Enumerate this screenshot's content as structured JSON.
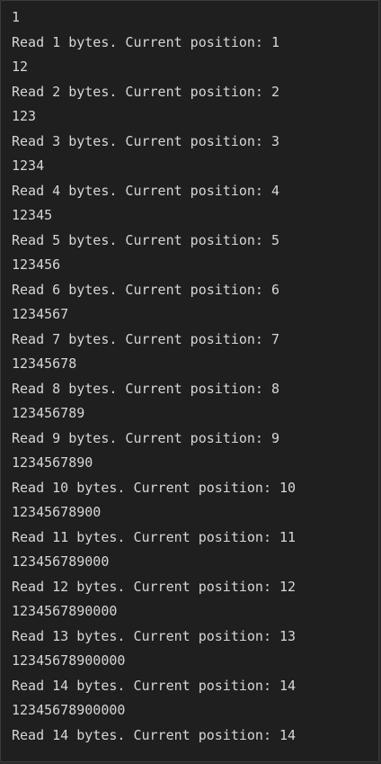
{
  "console": {
    "lines": [
      "1",
      "Read 1 bytes. Current position: 1",
      "12",
      "Read 2 bytes. Current position: 2",
      "123",
      "Read 3 bytes. Current position: 3",
      "1234",
      "Read 4 bytes. Current position: 4",
      "12345",
      "Read 5 bytes. Current position: 5",
      "123456",
      "Read 6 bytes. Current position: 6",
      "1234567",
      "Read 7 bytes. Current position: 7",
      "12345678",
      "Read 8 bytes. Current position: 8",
      "123456789",
      "Read 9 bytes. Current position: 9",
      "1234567890",
      "Read 10 bytes. Current position: 10",
      "12345678900",
      "Read 11 bytes. Current position: 11",
      "123456789000",
      "Read 12 bytes. Current position: 12",
      "1234567890000",
      "Read 13 bytes. Current position: 13",
      "12345678900000",
      "Read 14 bytes. Current position: 14",
      "12345678900000",
      "Read 14 bytes. Current position: 14"
    ]
  }
}
